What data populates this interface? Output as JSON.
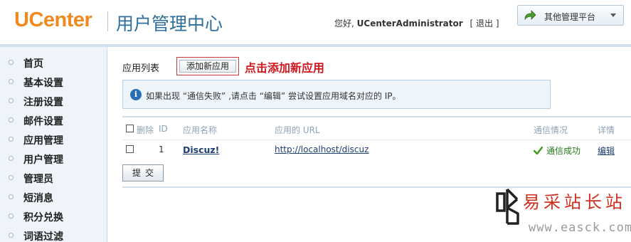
{
  "header": {
    "logo_text": "UCenter",
    "title": "用户管理中心",
    "greeting_prefix": "您好,",
    "username": "UCenterAdministrator",
    "logout_open": "[",
    "logout_label": "退出",
    "logout_close": "]",
    "platform_label": "其他管理平台",
    "platform_icon": "arrow-forward-icon"
  },
  "sidebar": {
    "items": [
      {
        "label": "首页"
      },
      {
        "label": "基本设置"
      },
      {
        "label": "注册设置"
      },
      {
        "label": "邮件设置"
      },
      {
        "label": "应用管理"
      },
      {
        "label": "用户管理"
      },
      {
        "label": "管理员"
      },
      {
        "label": "短消息"
      },
      {
        "label": "积分兑换"
      },
      {
        "label": "词语过滤"
      }
    ]
  },
  "main": {
    "list_title": "应用列表",
    "add_button_label": "添加新应用",
    "annotation": "点击添加新应用",
    "info_text": "如果出现 “通信失败” ,请点击 “编辑” 尝试设置应用域名对应的 IP。",
    "info_icon": "i",
    "table": {
      "headers": {
        "delete": "删除",
        "id": "ID",
        "name": "应用名称",
        "url": "应用的 URL",
        "status": "通信情况",
        "detail": "详情"
      },
      "rows": [
        {
          "id": "1",
          "name": "Discuz!",
          "url": "http://localhost/discuz",
          "status": "通信成功",
          "detail": "编辑"
        }
      ]
    },
    "submit_label": "提交"
  },
  "watermark": {
    "cn_text": "易采站长站",
    "url_text": "www.easck.com"
  },
  "colors": {
    "logo": "#f08a1e",
    "title": "#2e6f9c",
    "annotation": "#d2161d",
    "success": "#267a1a",
    "link": "#1d3f73"
  }
}
